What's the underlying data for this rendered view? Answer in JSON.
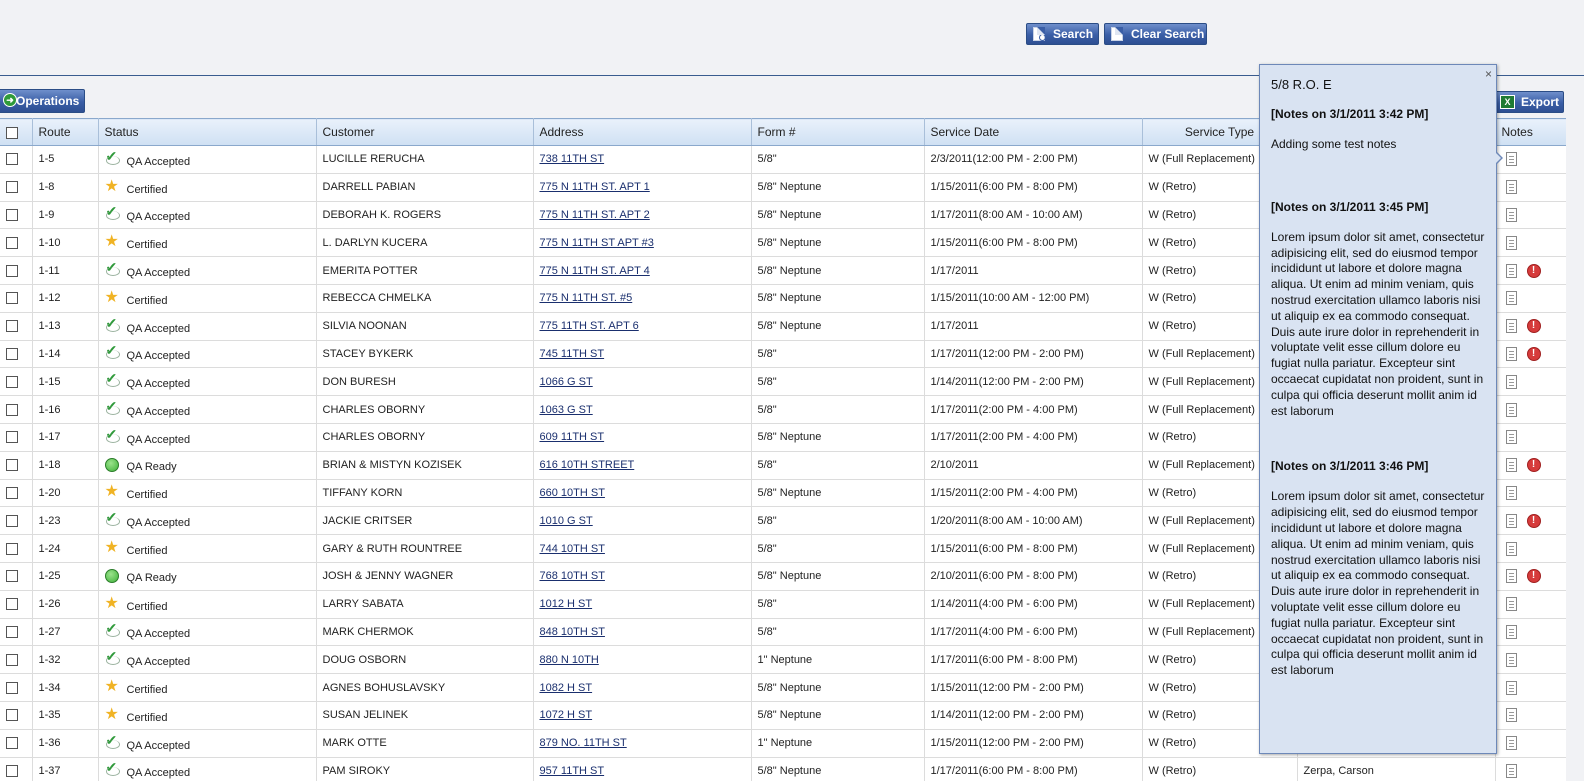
{
  "toolbar": {
    "search_label": "Search",
    "clear_search_label": "Clear Search",
    "operations_label": "Operations",
    "export_label": "Export"
  },
  "columns": [
    "Route",
    "Status",
    "Customer",
    "Address",
    "Form #",
    "Service Date",
    "Service Type",
    "Notes"
  ],
  "rows": [
    {
      "route": "1-5",
      "status": "QA Accepted",
      "status_icon": "check-icon",
      "customer": "LUCILLE RERUCHA",
      "address": "738 11TH ST",
      "form": "5/8\"",
      "date": "2/3/2011(12:00 PM - 2:00 PM)",
      "type": "W (Full Replacement)",
      "alert": false
    },
    {
      "route": "1-8",
      "status": "Certified",
      "status_icon": "star-icon",
      "customer": "DARRELL PABIAN",
      "address": "775 N 11TH ST. APT 1",
      "form": "5/8\" Neptune",
      "date": "1/15/2011(6:00 PM - 8:00 PM)",
      "type": "W (Retro)",
      "alert": false
    },
    {
      "route": "1-9",
      "status": "QA Accepted",
      "status_icon": "check-icon",
      "customer": "DEBORAH K. ROGERS",
      "address": "775 N 11TH ST. APT 2",
      "form": "5/8\" Neptune",
      "date": "1/17/2011(8:00 AM - 10:00 AM)",
      "type": "W (Retro)",
      "alert": false
    },
    {
      "route": "1-10",
      "status": "Certified",
      "status_icon": "star-icon",
      "customer": "L. DARLYN KUCERA",
      "address": "775 N 11TH ST APT #3",
      "form": "5/8\" Neptune",
      "date": "1/15/2011(6:00 PM - 8:00 PM)",
      "type": "W (Retro)",
      "alert": false
    },
    {
      "route": "1-11",
      "status": "QA Accepted",
      "status_icon": "check-icon",
      "customer": "EMERITA POTTER",
      "address": "775 N 11TH ST. APT 4",
      "form": "5/8\" Neptune",
      "date": "1/17/2011",
      "type": "W (Retro)",
      "alert": true
    },
    {
      "route": "1-12",
      "status": "Certified",
      "status_icon": "star-icon",
      "customer": "REBECCA CHMELKA",
      "address": "775 N 11TH ST. #5",
      "form": "5/8\" Neptune",
      "date": "1/15/2011(10:00 AM - 12:00 PM)",
      "type": "W (Retro)",
      "alert": false
    },
    {
      "route": "1-13",
      "status": "QA Accepted",
      "status_icon": "check-icon",
      "customer": "SILVIA NOONAN",
      "address": "775 11TH ST. APT 6",
      "form": "5/8\" Neptune",
      "date": "1/17/2011",
      "type": "W (Retro)",
      "alert": true
    },
    {
      "route": "1-14",
      "status": "QA Accepted",
      "status_icon": "check-icon",
      "customer": "STACEY BYKERK",
      "address": "745 11TH ST",
      "form": "5/8\"",
      "date": "1/17/2011(12:00 PM - 2:00 PM)",
      "type": "W (Full Replacement)",
      "alert": true
    },
    {
      "route": "1-15",
      "status": "QA Accepted",
      "status_icon": "check-icon",
      "customer": "DON BURESH",
      "address": "1066 G ST",
      "form": "5/8\"",
      "date": "1/14/2011(12:00 PM - 2:00 PM)",
      "type": "W (Full Replacement)",
      "alert": false
    },
    {
      "route": "1-16",
      "status": "QA Accepted",
      "status_icon": "check-icon",
      "customer": "CHARLES OBORNY",
      "address": "1063 G ST",
      "form": "5/8\"",
      "date": "1/17/2011(2:00 PM - 4:00 PM)",
      "type": "W (Full Replacement)",
      "alert": false
    },
    {
      "route": "1-17",
      "status": "QA Accepted",
      "status_icon": "check-icon",
      "customer": "CHARLES OBORNY",
      "address": "609 11TH ST",
      "form": "5/8\" Neptune",
      "date": "1/17/2011(2:00 PM - 4:00 PM)",
      "type": "W (Retro)",
      "alert": false
    },
    {
      "route": "1-18",
      "status": "QA Ready",
      "status_icon": "green-circle-icon",
      "customer": "BRIAN & MISTYN KOZISEK",
      "address": "616 10TH STREET",
      "form": "5/8\"",
      "date": "2/10/2011",
      "type": "W (Full Replacement)",
      "alert": true
    },
    {
      "route": "1-20",
      "status": "Certified",
      "status_icon": "star-icon",
      "customer": "TIFFANY KORN",
      "address": "660 10TH ST",
      "form": "5/8\" Neptune",
      "date": "1/15/2011(2:00 PM - 4:00 PM)",
      "type": "W (Retro)",
      "alert": false
    },
    {
      "route": "1-23",
      "status": "QA Accepted",
      "status_icon": "check-icon",
      "customer": "JACKIE CRITSER",
      "address": "1010 G ST",
      "form": "5/8\"",
      "date": "1/20/2011(8:00 AM - 10:00 AM)",
      "type": "W (Full Replacement)",
      "alert": true
    },
    {
      "route": "1-24",
      "status": "Certified",
      "status_icon": "star-icon",
      "customer": "GARY & RUTH ROUNTREE",
      "address": "744 10TH ST",
      "form": "5/8\"",
      "date": "1/15/2011(6:00 PM - 8:00 PM)",
      "type": "W (Full Replacement)",
      "alert": false
    },
    {
      "route": "1-25",
      "status": "QA Ready",
      "status_icon": "green-circle-icon",
      "customer": "JOSH & JENNY WAGNER",
      "address": "768 10TH ST",
      "form": "5/8\" Neptune",
      "date": "2/10/2011(6:00 PM - 8:00 PM)",
      "type": "W (Retro)",
      "alert": true
    },
    {
      "route": "1-26",
      "status": "Certified",
      "status_icon": "star-icon",
      "customer": "LARRY SABATA",
      "address": "1012 H ST",
      "form": "5/8\"",
      "date": "1/14/2011(4:00 PM - 6:00 PM)",
      "type": "W (Full Replacement)",
      "alert": false
    },
    {
      "route": "1-27",
      "status": "QA Accepted",
      "status_icon": "check-icon",
      "customer": "MARK CHERMOK",
      "address": "848 10TH ST",
      "form": "5/8\"",
      "date": "1/17/2011(4:00 PM - 6:00 PM)",
      "type": "W (Full Replacement)",
      "alert": false
    },
    {
      "route": "1-32",
      "status": "QA Accepted",
      "status_icon": "check-icon",
      "customer": "DOUG OSBORN",
      "address": "880 N 10TH",
      "form": "1\" Neptune",
      "date": "1/17/2011(6:00 PM - 8:00 PM)",
      "type": "W (Retro)",
      "alert": false
    },
    {
      "route": "1-34",
      "status": "Certified",
      "status_icon": "star-icon",
      "customer": "AGNES BOHUSLAVSKY",
      "address": "1082 H ST",
      "form": "5/8\" Neptune",
      "date": "1/15/2011(12:00 PM - 2:00 PM)",
      "type": "W (Retro)",
      "alert": false
    },
    {
      "route": "1-35",
      "status": "Certified",
      "status_icon": "star-icon",
      "customer": "SUSAN JELINEK",
      "address": "1072 H ST",
      "form": "5/8\" Neptune",
      "date": "1/14/2011(12:00 PM - 2:00 PM)",
      "type": "W (Retro)",
      "alert": false
    },
    {
      "route": "1-36",
      "status": "QA Accepted",
      "status_icon": "check-icon",
      "customer": "MARK OTTE",
      "address": "879 NO. 11TH ST",
      "form": "1\" Neptune",
      "date": "1/15/2011(12:00 PM - 2:00 PM)",
      "type": "W (Retro)",
      "alert": false
    },
    {
      "route": "1-37",
      "status": "QA Accepted",
      "status_icon": "check-icon",
      "customer": "PAM SIROKY",
      "address": "957 11TH ST",
      "form": "5/8\" Neptune",
      "date": "1/17/2011(6:00 PM - 8:00 PM)",
      "type": "W (Retro)",
      "extra": "Zerpa, Carson",
      "alert": false
    }
  ],
  "popup": {
    "title": "5/8 R.O. E",
    "close_glyph": "×",
    "notes": [
      {
        "heading": "[Notes on 3/1/2011 3:42 PM]",
        "body": "Adding some test notes"
      },
      {
        "heading": "[Notes on 3/1/2011 3:45 PM]",
        "body": "Lorem ipsum dolor sit amet, consectetur adipisicing elit, sed do eiusmod tempor incididunt ut labore et dolore magna aliqua. Ut enim ad minim veniam, quis nostrud exercitation ullamco laboris nisi ut aliquip ex ea commodo consequat. Duis aute irure dolor in reprehenderit in voluptate velit esse cillum dolore eu fugiat nulla pariatur. Excepteur sint occaecat cupidatat non proident, sunt in culpa qui officia deserunt mollit anim id est laborum"
      },
      {
        "heading": "[Notes on 3/1/2011 3:46 PM]",
        "body": "Lorem ipsum dolor sit amet, consectetur adipisicing elit, sed do eiusmod tempor incididunt ut labore et dolore magna aliqua. Ut enim ad minim veniam, quis nostrud exercitation ullamco laboris nisi ut aliquip ex ea commodo consequat. Duis aute irure dolor in reprehenderit in voluptate velit esse cillum dolore eu fugiat nulla pariatur. Excepteur sint occaecat cupidatat non proident, sunt in culpa qui officia deserunt mollit anim id est laborum"
      }
    ]
  },
  "colors": {
    "accent": "#3a5ea6",
    "popup_bg": "#d9e3f2",
    "header_bg": "#cfe0f3",
    "link": "#1a2f6e"
  }
}
